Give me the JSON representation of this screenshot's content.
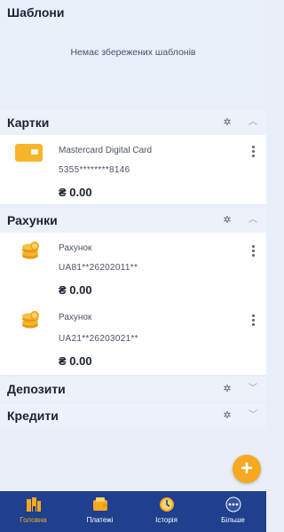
{
  "templates": {
    "title": "Шаблони",
    "empty_text": "Немає збережених шаблонів"
  },
  "cards": {
    "title": "Картки",
    "items": [
      {
        "name": "Mastercard Digital Card",
        "number": "5355********8146",
        "balance": "₴ 0.00"
      }
    ]
  },
  "accounts": {
    "title": "Рахунки",
    "items": [
      {
        "name": "Рахунок",
        "number": "UA81**26202011**",
        "balance": "₴ 0.00"
      },
      {
        "name": "Рахунок",
        "number": "UA21**26203021**",
        "balance": "₴ 0.00"
      }
    ]
  },
  "deposits": {
    "title": "Депозити"
  },
  "credits": {
    "title": "Кредити"
  },
  "fab": {
    "label": "+"
  },
  "tabbar": {
    "items": [
      {
        "label": "Головна",
        "icon": "home-icon",
        "active": true
      },
      {
        "label": "Платежі",
        "icon": "payments-icon",
        "active": false
      },
      {
        "label": "Історія",
        "icon": "history-icon",
        "active": false
      },
      {
        "label": "Більше",
        "icon": "more-icon",
        "active": false
      }
    ]
  },
  "colors": {
    "accent": "#f5a820",
    "tabbar_bg": "#1f3f8f",
    "page_bg": "#e9eef8"
  }
}
